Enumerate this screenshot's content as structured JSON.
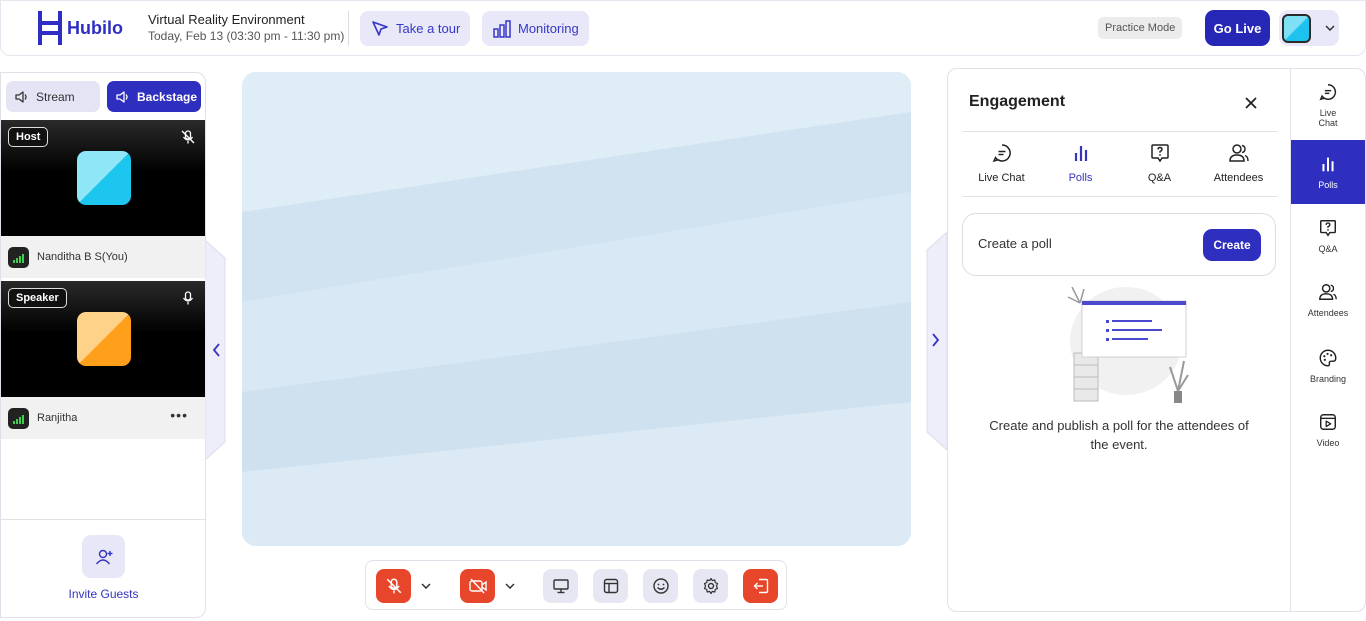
{
  "header": {
    "logo_text": "Hubilo",
    "event_title": "Virtual Reality Environment",
    "event_time": "Today, Feb 13 (03:30 pm - 11:30 pm)",
    "take_tour_label": "Take a tour",
    "monitoring_label": "Monitoring",
    "practice_mode_label": "Practice Mode",
    "go_live_label": "Go Live"
  },
  "left_panel": {
    "stream_label": "Stream",
    "backstage_label": "Backstage",
    "participants": [
      {
        "role": "Host",
        "name": "Nanditha B S(You)",
        "mic": "muted"
      },
      {
        "role": "Speaker",
        "name": "Ranjitha",
        "mic": "on"
      }
    ],
    "invite_label": "Invite Guests"
  },
  "toolbar": {
    "buttons": [
      "mic-muted-icon",
      "camera-off-icon",
      "screen-share-icon",
      "layout-icon",
      "emoji-icon",
      "settings-icon",
      "leave-icon"
    ]
  },
  "engagement": {
    "title": "Engagement",
    "tabs": [
      "Live Chat",
      "Polls",
      "Q&A",
      "Attendees"
    ],
    "active_tab": "Polls",
    "create_poll_label": "Create a poll",
    "create_button_label": "Create",
    "empty_state_text": "Create and publish a poll for the attendees of the event."
  },
  "rail": {
    "items": [
      "Live Chat",
      "Polls",
      "Q&A",
      "Attendees",
      "Branding",
      "Video"
    ],
    "active": "Polls"
  },
  "colors": {
    "brand": "#2f2fbf",
    "accent_light": "#e7e7f4",
    "danger": "#e8462a",
    "stage_bg": "#d6e6f3"
  }
}
